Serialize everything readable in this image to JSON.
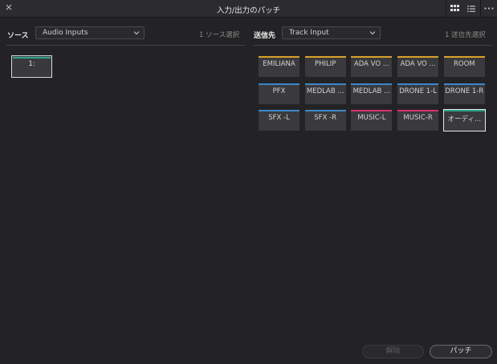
{
  "window": {
    "title": "入力/出力のパッチ"
  },
  "source": {
    "label": "ソース",
    "selected": "Audio Inputs",
    "count": "1 ソース選択",
    "items": [
      {
        "label": "1:",
        "color": "#2fa28a"
      }
    ]
  },
  "destination": {
    "label": "送信先",
    "selected": "Track Input",
    "count": "1 送信先選択",
    "items": [
      {
        "label": "EMILIANA",
        "color": "#d8a12b"
      },
      {
        "label": "PHILIP",
        "color": "#d8a12b"
      },
      {
        "label": "ADA VO ...",
        "color": "#d8a12b"
      },
      {
        "label": "ADA VO ...",
        "color": "#d8a12b"
      },
      {
        "label": "ROOM",
        "color": "#d8a12b"
      },
      {
        "label": "PFX",
        "color": "#3d87c9"
      },
      {
        "label": "MEDLAB ...",
        "color": "#3d87c9"
      },
      {
        "label": "MEDLAB ...",
        "color": "#3d87c9"
      },
      {
        "label": "DRONE 1-L",
        "color": "#3d87c9"
      },
      {
        "label": "DRONE 1-R",
        "color": "#3d87c9"
      },
      {
        "label": "SFX -L",
        "color": "#3d87c9"
      },
      {
        "label": "SFX -R",
        "color": "#3d87c9"
      },
      {
        "label": "MUSIC-L",
        "color": "#d9336c"
      },
      {
        "label": "MUSIC-R",
        "color": "#d9336c"
      },
      {
        "label": "オーディ...",
        "color": "#2fa28a",
        "selected": true
      }
    ]
  },
  "buttons": {
    "unpatch": "解除",
    "patch": "パッチ"
  },
  "icons": {
    "close": "close-icon",
    "grid": "grid-view-icon",
    "list": "list-view-icon",
    "more": "more-icon"
  }
}
